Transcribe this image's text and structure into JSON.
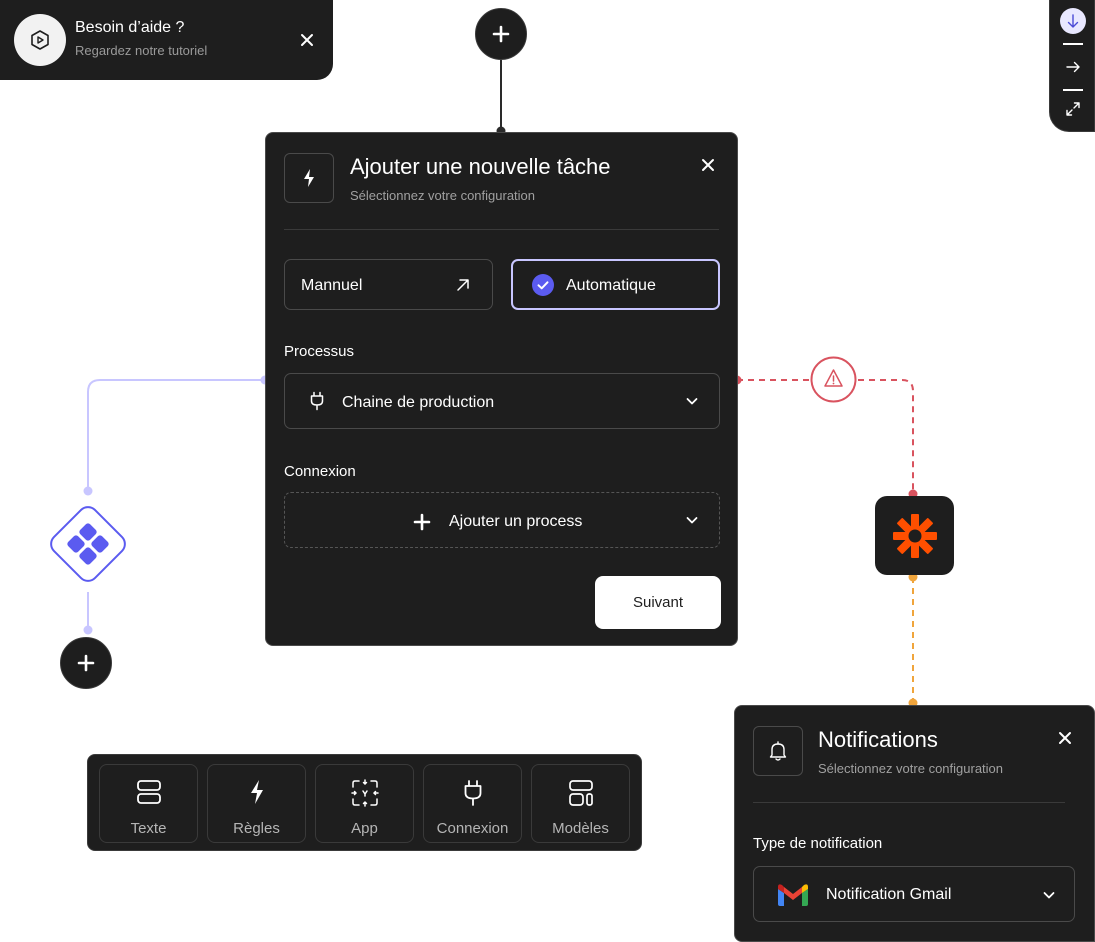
{
  "help_toast": {
    "title": "Besoin d’aide ?",
    "subtitle": "Regardez notre tutoriel"
  },
  "task_panel": {
    "title": "Ajouter une nouvelle tâche",
    "subtitle": "Sélectionnez votre configuration",
    "modes": {
      "manual_label": "Mannuel",
      "automatic_label": "Automatique",
      "selected": "Automatique"
    },
    "process": {
      "label": "Processus",
      "value": "Chaine de production"
    },
    "connection": {
      "label": "Connexion",
      "placeholder": "Ajouter un process"
    },
    "next_label": "Suivant"
  },
  "toolbar": {
    "items": [
      {
        "label": "Texte",
        "icon": "text-block-icon"
      },
      {
        "label": "Règles",
        "icon": "lightning-icon"
      },
      {
        "label": "App",
        "icon": "app-scan-icon"
      },
      {
        "label": "Connexion",
        "icon": "plug-icon"
      },
      {
        "label": "Modèles",
        "icon": "templates-icon"
      }
    ]
  },
  "notifications_panel": {
    "title": "Notifications",
    "subtitle": "Sélectionnez votre configuration",
    "type_label": "Type de notification",
    "type_value": "Notification Gmail"
  },
  "colors": {
    "panel_bg": "#1e1e1e",
    "accent_purple": "#5b5bf0",
    "purple_line": "#c8c6ff",
    "error_red": "#d9535f",
    "zapier_orange": "#ff4f00",
    "warning_orange": "#f0a53c"
  }
}
